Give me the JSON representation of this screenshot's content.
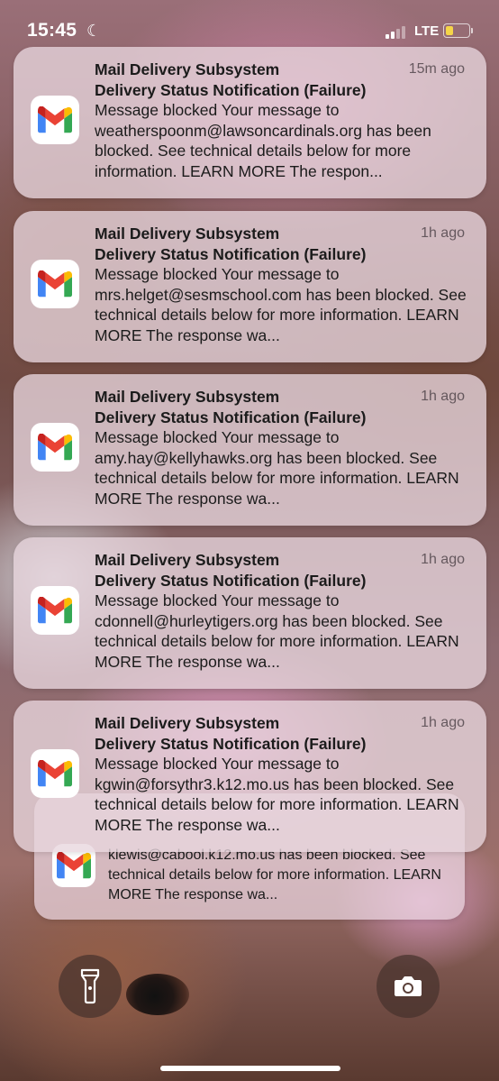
{
  "status_bar": {
    "time": "15:45",
    "network": "LTE",
    "battery_color": "#f5d548"
  },
  "notifications": [
    {
      "sender": "Mail Delivery Subsystem",
      "subject": "Delivery Status Notification (Failure)",
      "body": "Message blocked Your message to weatherspoonm@lawsoncardinals.org has been blocked. See technical details below for more information. LEARN MORE The respon...",
      "time": "15m ago"
    },
    {
      "sender": "Mail Delivery Subsystem",
      "subject": "Delivery Status Notification (Failure)",
      "body": "Message blocked Your message to mrs.helget@sesmschool.com has been blocked. See technical details below for more information. LEARN MORE The response wa...",
      "time": "1h ago"
    },
    {
      "sender": "Mail Delivery Subsystem",
      "subject": "Delivery Status Notification (Failure)",
      "body": "Message blocked Your message to amy.hay@kellyhawks.org has been blocked. See technical details below for more information. LEARN MORE The response wa...",
      "time": "1h ago"
    },
    {
      "sender": "Mail Delivery Subsystem",
      "subject": "Delivery Status Notification (Failure)",
      "body": "Message blocked Your message to cdonnell@hurleytigers.org has been blocked. See technical details below for more information. LEARN MORE The response wa...",
      "time": "1h ago"
    },
    {
      "sender": "Mail Delivery Subsystem",
      "subject": "Delivery Status Notification (Failure)",
      "body": "Message blocked Your message to kgwin@forsythr3.k12.mo.us has been blocked. See technical details below for more information. LEARN MORE The response wa...",
      "time": "1h ago"
    }
  ],
  "stacked_notification": {
    "body": "klewis@cabool.k12.mo.us has been blocked. See technical details below for more information. LEARN MORE The response wa..."
  },
  "quick_actions": {
    "flashlight_icon": "flashlight-icon",
    "camera_icon": "camera-icon"
  },
  "icon_colors": {
    "gmail_red": "#EA4335",
    "gmail_blue": "#4285F4",
    "gmail_green": "#34A853",
    "gmail_yellow": "#FBBC04",
    "gmail_dark_red": "#C5221F"
  }
}
